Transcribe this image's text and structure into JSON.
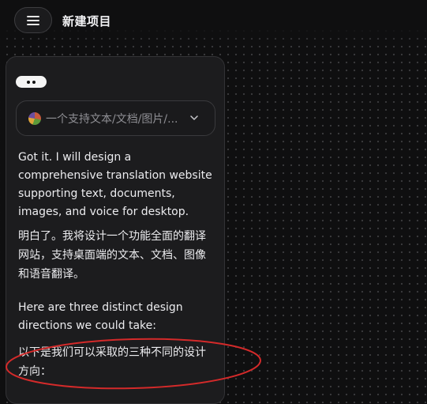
{
  "header": {
    "title": "新建项目"
  },
  "panel": {
    "project_selector": {
      "label": "一个支持文本/文档/图片/...",
      "icon": "chevron-down-icon"
    },
    "messages": [
      "Got it. I will design a comprehensive translation website supporting text, documents, images, and voice for desktop.",
      "明白了。我将设计一个功能全面的翻译网站，支持桌面端的文本、文档、图像和语音翻译。",
      "Here are three distinct design directions we could take:",
      "以下是我们可以采取的三种不同的设计方向："
    ]
  },
  "colors": {
    "background": "#0f0f10",
    "panel": "#1c1c1e",
    "annotation": "#d42a2a"
  }
}
